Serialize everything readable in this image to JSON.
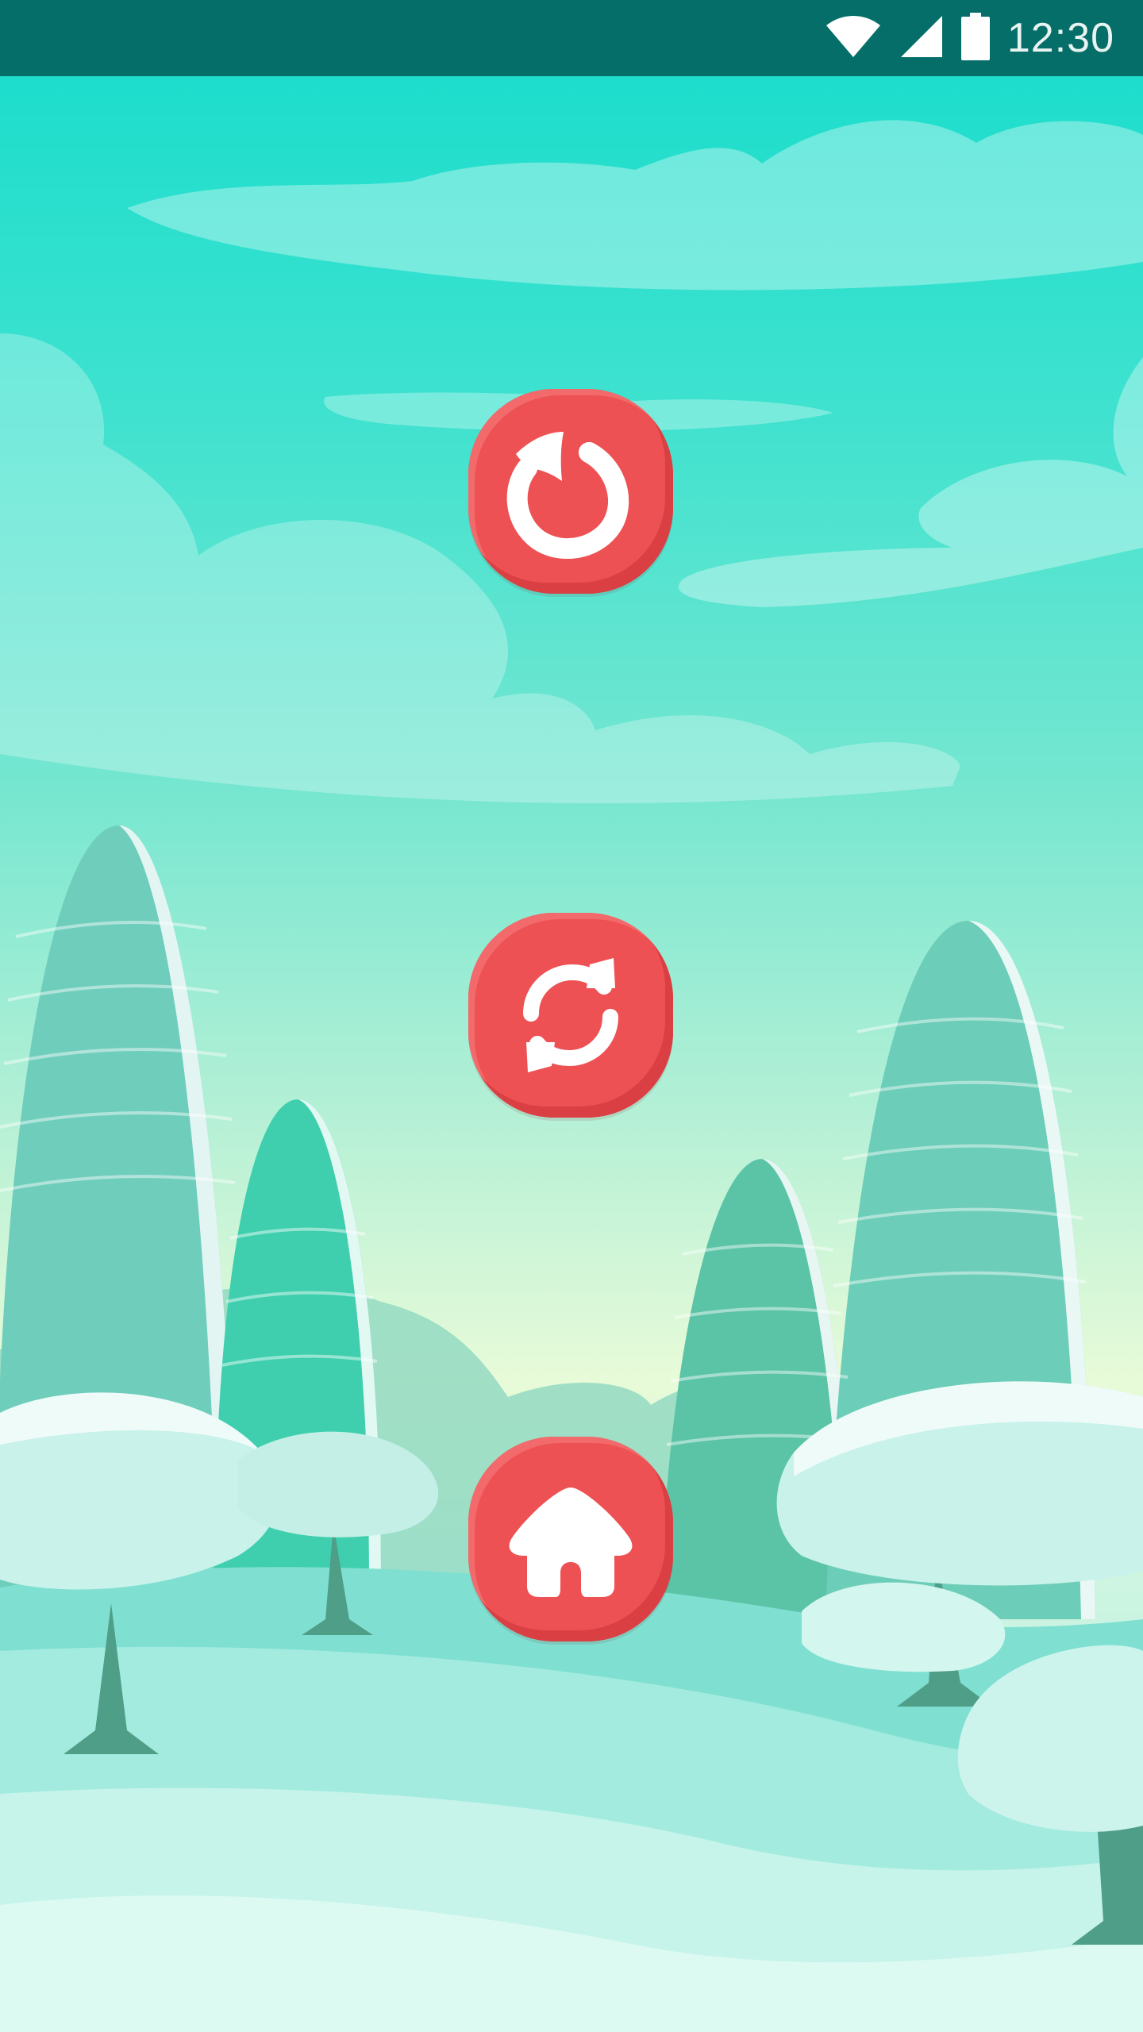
{
  "status_bar": {
    "time": "12:30",
    "background_color": "#066e68",
    "icons": [
      "wifi-icon",
      "cellular-signal-icon",
      "battery-icon"
    ]
  },
  "buttons": [
    {
      "name": "undo-button",
      "icon": "undo-arrow-icon",
      "color": "#ee5153"
    },
    {
      "name": "restart-button",
      "icon": "refresh-icon",
      "color": "#ee5153"
    },
    {
      "name": "home-button",
      "icon": "home-icon",
      "color": "#ee5153"
    }
  ],
  "background": {
    "sky_top_color": "#16dccb",
    "horizon_color": "#e8fbd8",
    "ground_color": "#a8ede3"
  }
}
